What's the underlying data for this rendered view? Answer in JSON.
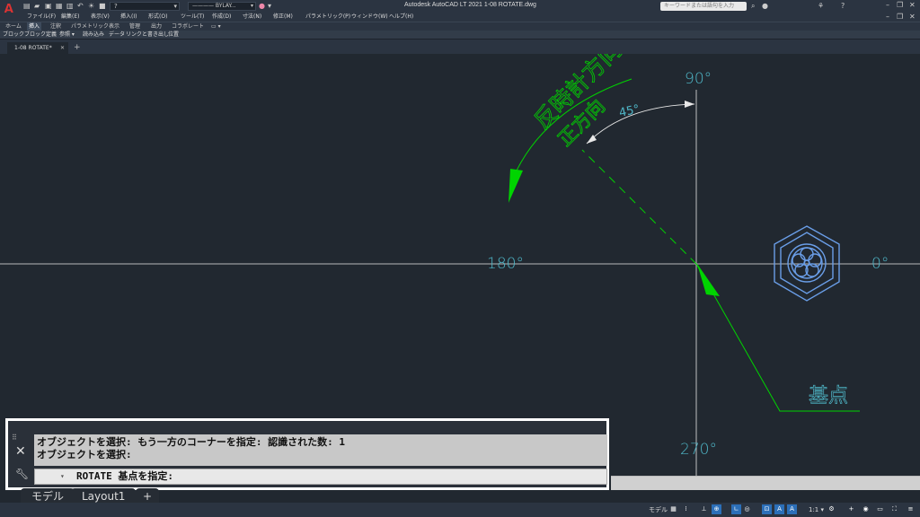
{
  "titlebar": {
    "app_title": "Autodesk AutoCAD LT 2021    1-08 ROTATE.dwg",
    "layer": "?",
    "linetype": "———— BYLAY...",
    "search_placeholder": "キーワードまたは語句を入力",
    "logo": "A"
  },
  "menu": [
    "ファイル(F)",
    "編集(E)",
    "表示(V)",
    "挿入(I)",
    "形式(O)",
    "ツール(T)",
    "作成(D)",
    "寸法(N)",
    "修正(M)",
    "パラメトリック(P)",
    "ウィンドウ(W)",
    "ヘルプ(H)"
  ],
  "ribbon_tabs": [
    "ホーム",
    "挿入",
    "注釈",
    "パラメトリック",
    "表示",
    "管理",
    "出力",
    "コラボレート",
    "▭ ▾"
  ],
  "ribbon_panels": [
    "ブロック",
    "ブロック定義",
    "参照 ▾",
    "読み込み",
    "データ",
    "リンクと書き出し",
    "位置"
  ],
  "file_tab": {
    "name": "1-08 ROTATE*",
    "close": "✕",
    "new": "+"
  },
  "canvas": {
    "angles": {
      "deg90": "90°",
      "deg0": "0°",
      "deg180": "180°",
      "deg270": "270°"
    },
    "dim_angle": "45°",
    "ccw_label": "反時計方向",
    "positive_label": "正方向",
    "base_point_label": "基点",
    "colors": {
      "axis": "#e8e8e8",
      "annotation": "#00d400",
      "angle_text": "#4fb7c8",
      "object": "#6a9ee8"
    }
  },
  "command": {
    "history": [
      "オブジェクトを選択: もう一方のコーナーを指定: 認識された数: 1",
      "オブジェクトを選択:"
    ],
    "prompt": "ROTATE 基点を指定:",
    "close_icon": "✕",
    "handle_icon": "⠿"
  },
  "layout_tabs": [
    "モデル",
    "Layout1",
    "+"
  ],
  "statusbar": {
    "model": "モデル",
    "scale": "1:1 ▾"
  }
}
